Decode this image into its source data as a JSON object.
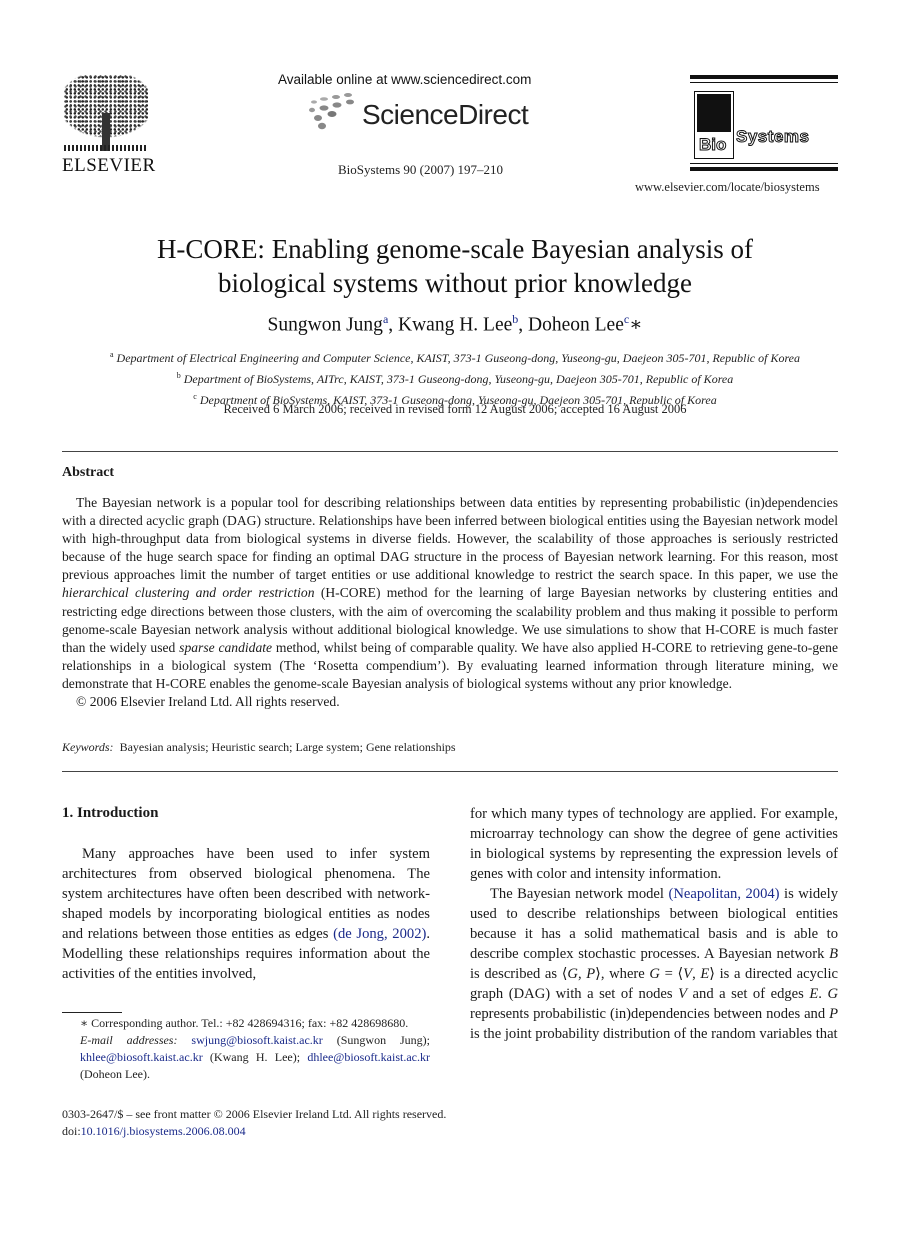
{
  "header": {
    "publisher": "ELSEVIER",
    "available_online": "Available online at www.sciencedirect.com",
    "sciencedirect": "ScienceDirect",
    "journal_ref": "BioSystems 90 (2007) 197–210",
    "journal_logo_bio": "Bio",
    "journal_logo_systems": "Systems",
    "journal_url": "www.elsevier.com/locate/biosystems"
  },
  "paper": {
    "title_line1": "H-CORE: Enabling genome-scale Bayesian analysis of",
    "title_line2": "biological systems without prior knowledge",
    "authors": [
      {
        "name": "Sungwon Jung",
        "mark": "a",
        "sep": ", "
      },
      {
        "name": "Kwang H. Lee",
        "mark": "b",
        "sep": ", "
      },
      {
        "name": "Doheon Lee",
        "mark": "c",
        "sep": "∗"
      }
    ],
    "affiliations": [
      {
        "mark": "a",
        "text": "Department of Electrical Engineering and Computer Science, KAIST, 373-1 Guseong-dong, Yuseong-gu, Daejeon 305-701, Republic of Korea"
      },
      {
        "mark": "b",
        "text": "Department of BioSystems, AITrc, KAIST, 373-1 Guseong-dong, Yuseong-gu, Daejeon 305-701, Republic of Korea"
      },
      {
        "mark": "c",
        "text": "Department of BioSystems, KAIST, 373-1 Guseong-dong, Yuseong-gu, Daejeon 305-701, Republic of Korea"
      }
    ],
    "received": "Received 6 March 2006; received in revised form 12 August 2006; accepted 16 August 2006"
  },
  "abstract": {
    "heading": "Abstract",
    "part1": "The Bayesian network is a popular tool for describing relationships between data entities by representing probabilistic (in)dependencies with a directed acyclic graph (DAG) structure. Relationships have been inferred between biological entities using the Bayesian network model with high-throughput data from biological systems in diverse fields. However, the scalability of those approaches is seriously restricted because of the huge search space for finding an optimal DAG structure in the process of Bayesian network learning. For this reason, most previous approaches limit the number of target entities or use additional knowledge to restrict the search space. In this paper, we use the ",
    "italic1": "hierarchical clustering and order restriction",
    "part2": " (H-CORE) method for the learning of large Bayesian networks by clustering entities and restricting edge directions between those clusters, with the aim of overcoming the scalability problem and thus making it possible to perform genome-scale Bayesian network analysis without additional biological knowledge. We use simulations to show that H-CORE is much faster than the widely used ",
    "italic2": "sparse candidate",
    "part3": " method, whilst being of comparable quality. We have also applied H-CORE to retrieving gene-to-gene relationships in a biological system (The ‘Rosetta compendium’). By evaluating learned information through literature mining, we demonstrate that H-CORE enables the genome-scale Bayesian analysis of biological systems without any prior knowledge.",
    "copyright": "© 2006 Elsevier Ireland Ltd. All rights reserved.",
    "keywords_label": "Keywords:",
    "keywords": "Bayesian analysis; Heuristic search; Large system; Gene relationships"
  },
  "introduction": {
    "heading": "1. Introduction",
    "left_p1_a": "Many approaches have been used to infer system architectures from observed biological phenomena. The system architectures have often been described with network-shaped models by incorporating biological entities as nodes and relations between those entities as edges ",
    "left_cite1": "(de Jong, 2002)",
    "left_p1_b": ". Modelling these relationships requires information about the activities of the entities involved,",
    "right_p1": "for which many types of technology are applied. For example, microarray technology can show the degree of gene activities in biological systems by representing the expression levels of genes with color and intensity information.",
    "right_p2_a": "The Bayesian network model ",
    "right_cite2": "(Neapolitan, 2004)",
    "right_p2_b": " is widely used to describe relationships between biological entities because it has a solid mathematical basis and is able to describe complex stochastic processes. A Bayesian network ",
    "var_B": "B",
    "right_p2_c": " is described as ⟨",
    "var_G": "G",
    "comma": ", ",
    "var_P": "P",
    "right_p2_d": "⟩, where ",
    "right_p2_e": " = ⟨",
    "var_V": "V",
    "var_E": "E",
    "right_p2_f": "⟩ is a directed acyclic graph (DAG) with a set of nodes ",
    "right_p2_g": " and a set of edges ",
    "right_p2_h": ". ",
    "right_p2_i": " represents probabilistic (in)dependencies between nodes and ",
    "right_p2_j": " is the joint probability distribution of the random variables that"
  },
  "footnotes": {
    "corresponding": "∗ Corresponding author. Tel.: +82 428694316; fax: +82 428698680.",
    "email_label": "E-mail addresses:",
    "emails": [
      {
        "address": "swjung@biosoft.kaist.ac.kr",
        "owner": " (Sungwon Jung); "
      },
      {
        "address": "khlee@biosoft.kaist.ac.kr",
        "owner": " (Kwang H. Lee); "
      },
      {
        "address": "dhlee@biosoft.kaist.ac.kr",
        "owner": " (Doheon Lee)."
      }
    ]
  },
  "front_matter": {
    "issn_line": "0303-2647/$ – see front matter © 2006 Elsevier Ireland Ltd. All rights reserved.",
    "doi_label": "doi:",
    "doi": "10.1016/j.biosystems.2006.08.004"
  },
  "colors": {
    "link": "#1a2a8a",
    "text": "#1a1a1a"
  }
}
